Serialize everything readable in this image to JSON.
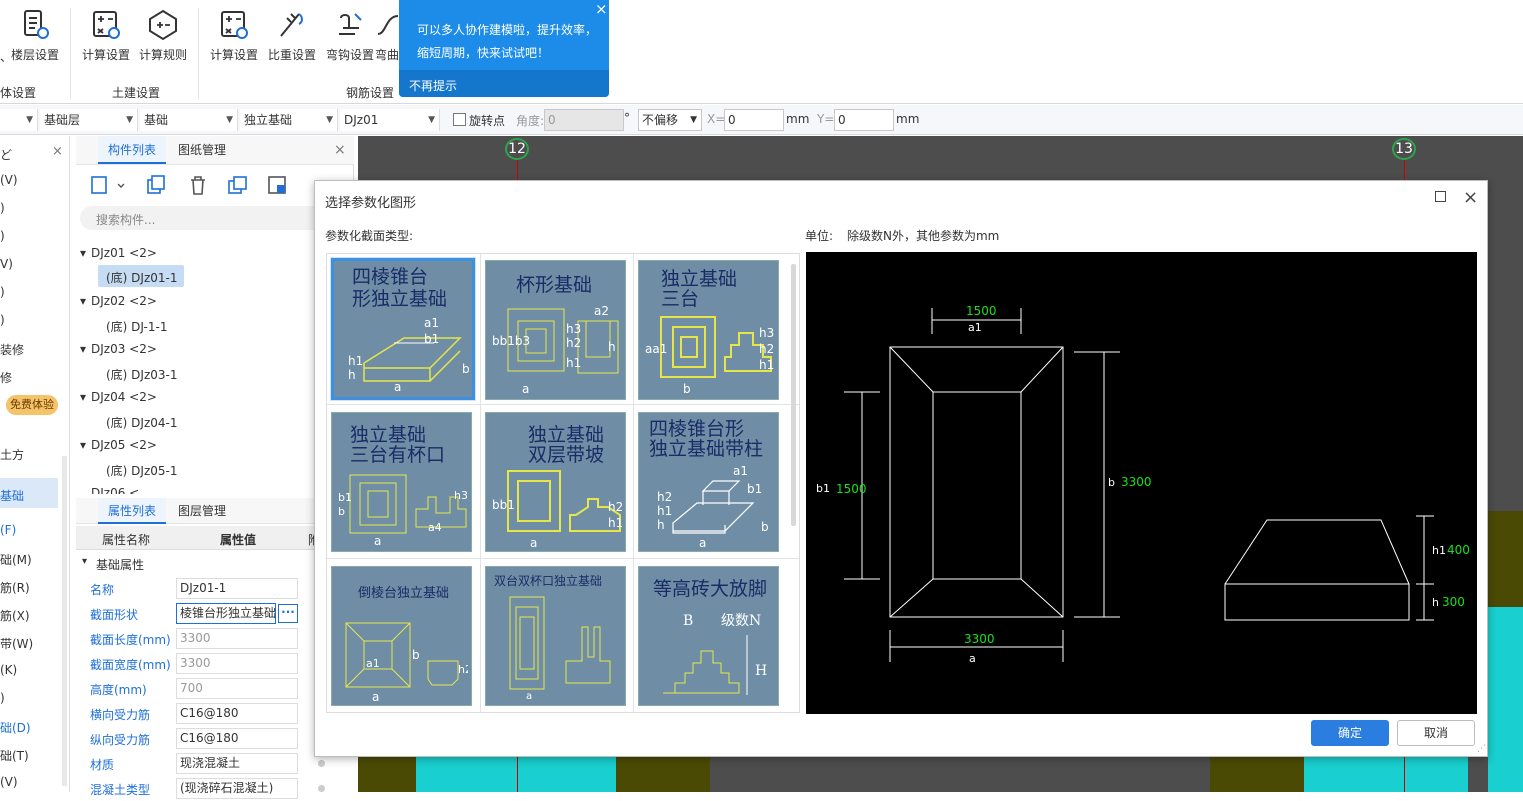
{
  "ribbon": {
    "floor_btn": "楼层设置",
    "civil_calc": "计算设置",
    "civil_rule": "计算规则",
    "civil_group": "土建设置",
    "rebar_calc": "计算设置",
    "rebar_weight": "比重设置",
    "rebar_hook": "弯钩设置",
    "rebar_more": "弯曲",
    "rebar_group": "钢筋设置",
    "left_group": "体设置",
    "left_fragment": "、"
  },
  "toolbar": {
    "layer": "基础层",
    "category": "基础",
    "type": "独立基础",
    "name": "DJz01",
    "rotate_label": "旋转点",
    "angle_label": "角度:",
    "angle_value": "0",
    "degree": "°",
    "offset": "不偏移",
    "x_label": "X=",
    "x_value": "0",
    "x_unit": "mm",
    "y_label": "Y=",
    "y_value": "0",
    "y_unit": "mm"
  },
  "leftnav": [
    "ど",
    "(V)",
    ")",
    ")",
    "V)",
    ")",
    ")",
    "装修",
    "修",
    "免费体验",
    "土方",
    "基础",
    "(F)",
    "础(M)",
    "筋(R)",
    "筋(X)",
    "带(W)",
    "(K)",
    ")",
    "础(D)",
    "础(T)",
    "(V)"
  ],
  "components": {
    "tab_list": "构件列表",
    "tab_drawing": "图纸管理",
    "search_placeholder": "搜索构件...",
    "tree": [
      {
        "label": "DJz01  <2>",
        "child": "(底) DJz01-1"
      },
      {
        "label": "DJz02  <2>",
        "child": "(底) DJ-1-1"
      },
      {
        "label": "DJz03  <2>",
        "child": "(底) DJz03-1"
      },
      {
        "label": "DJz04  <2>",
        "child": "(底) DJz04-1"
      },
      {
        "label": "DJz05  <2>",
        "child": "(底) DJz05-1"
      }
    ],
    "tree_cut": "DJz06  <"
  },
  "props": {
    "tab_props": "属性列表",
    "tab_layer": "图层管理",
    "col_name": "属性名称",
    "col_value": "属性值",
    "col_extra": "附",
    "group": "基础属性",
    "rows": [
      {
        "name": "名称",
        "value": "DJz01-1"
      },
      {
        "name": "截面形状",
        "value": "棱锥台形独立基础"
      },
      {
        "name": "截面长度(mm)",
        "value": "3300"
      },
      {
        "name": "截面宽度(mm)",
        "value": "3300"
      },
      {
        "name": "高度(mm)",
        "value": "700"
      },
      {
        "name": "横向受力筋",
        "value": "C16@180"
      },
      {
        "name": "纵向受力筋",
        "value": "C16@180"
      },
      {
        "name": "材质",
        "value": "现浇混凝土"
      },
      {
        "name": "混凝土类型",
        "value": "(现浇碎石混凝土)"
      }
    ]
  },
  "canvas": {
    "axis_left": "12",
    "axis_right": "13"
  },
  "tooltip": {
    "line1": "可以多人协作建模啦，提升效率，",
    "line2": "缩短周期，快来试试吧！",
    "dismiss": "不再提示",
    "close": "×"
  },
  "dialog": {
    "title": "选择参数化图形",
    "type_label": "参数化截面类型:",
    "unit_label": "单位:",
    "unit_text": "除级数N外，其他参数为mm",
    "thumbs": [
      {
        "title1": "四棱锥台",
        "title2": "形独立基础"
      },
      {
        "title1": "杯形基础",
        "title2": ""
      },
      {
        "title1": "独立基础",
        "title2": "三台"
      },
      {
        "title1": "独立基础",
        "title2": "三台有杯口"
      },
      {
        "title1": "独立基础",
        "title2": "双层带坡"
      },
      {
        "title1": "四棱锥台形",
        "title2": "独立基础带柱"
      },
      {
        "title1": "倒棱台独立基础",
        "title2": ""
      },
      {
        "title1": "双台双杯口独立基础",
        "title2": ""
      },
      {
        "title1": "等高砖大放脚",
        "title2": ""
      }
    ],
    "preview": {
      "a1_value": "1500",
      "a1_label": "a1",
      "b1_label": "b1",
      "b1_value": "1500",
      "b_label": "b",
      "b_value": "3300",
      "a_value": "3300",
      "a_label": "a",
      "h1_label": "h1",
      "h1_value": "400",
      "h_label": "h",
      "h_value": "300"
    },
    "ok": "确定",
    "cancel": "取消"
  },
  "colors": {
    "accent": "#1e6fd9",
    "tooltip": "#1c8ce8",
    "thumb_bg": "#6f8ea6",
    "canvas_cyan": "#19cfcf",
    "canvas_olive": "#4a4a05"
  }
}
